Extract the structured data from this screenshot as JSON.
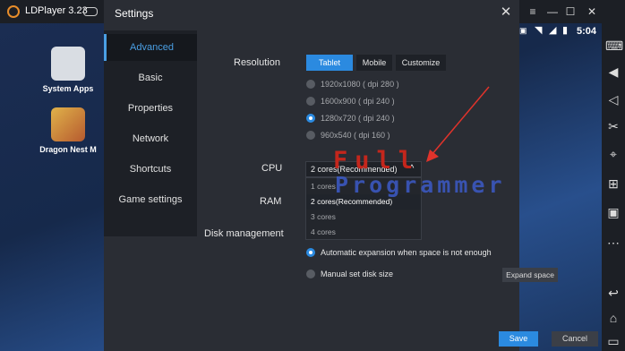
{
  "window": {
    "title": "LDPlayer 3.23"
  },
  "dialog": {
    "title": "Settings"
  },
  "nav": {
    "items": [
      "Advanced",
      "Basic",
      "Properties",
      "Network",
      "Shortcuts",
      "Game settings"
    ]
  },
  "resolution": {
    "label": "Resolution",
    "tabs": [
      "Tablet",
      "Mobile",
      "Customize"
    ],
    "options": [
      "1920x1080 ( dpi 280 )",
      "1600x900 ( dpi 240 )",
      "1280x720 ( dpi 240 )",
      "960x540 ( dpi 160 )"
    ]
  },
  "cpu": {
    "label": "CPU",
    "value": "2 cores(Recommended)",
    "options": [
      "1 cores",
      "2 cores(Recommended)",
      "3 cores",
      "4 cores"
    ]
  },
  "ram": {
    "label": "RAM"
  },
  "disk": {
    "label": "Disk management",
    "auto": "Automatic expansion when space is not enough",
    "manual": "Manual set disk size",
    "expand": "Expand space"
  },
  "buttons": {
    "save": "Save",
    "cancel": "Cancel"
  },
  "desktop": {
    "icons": [
      "System Apps",
      "Dragon Nest M"
    ]
  },
  "statusbar": {
    "time": "5:04"
  },
  "watermark": {
    "line1": "Full",
    "line2": "Programmer"
  },
  "colors": {
    "accent": "#2b8ae0",
    "dialog_bg": "#2a2d34",
    "nav_bg": "#1d2026"
  }
}
